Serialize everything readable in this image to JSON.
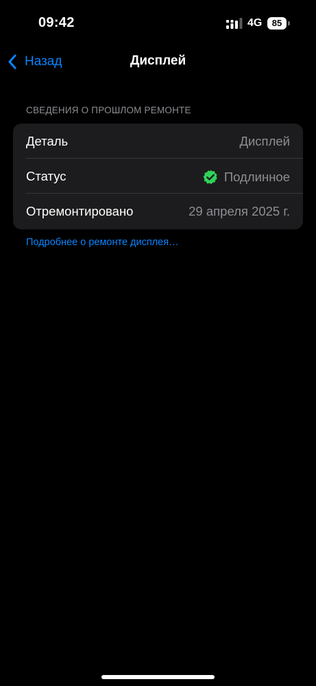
{
  "status_bar": {
    "time": "09:42",
    "network": "4G",
    "battery": "85",
    "signal_icon": "cellular-signal-icon",
    "battery_icon": "battery-icon"
  },
  "nav": {
    "back_label": "Назад",
    "back_icon": "chevron-left-icon",
    "title": "Дисплей"
  },
  "section": {
    "header": "СВЕДЕНИЯ О ПРОШЛОМ РЕМОНТЕ",
    "rows": [
      {
        "label": "Деталь",
        "value": "Дисплей"
      },
      {
        "label": "Статус",
        "value": "Подлинное",
        "icon": "checkmark-seal-icon"
      },
      {
        "label": "Отремонтировано",
        "value": "29 апреля 2025 г."
      }
    ],
    "footer_link": "Подробнее о ремонте дисплея…"
  },
  "colors": {
    "background": "#000000",
    "card": "#1c1c1e",
    "accent": "#0a84ff",
    "secondary_text": "#8d8d93",
    "verified_green": "#30d158"
  }
}
